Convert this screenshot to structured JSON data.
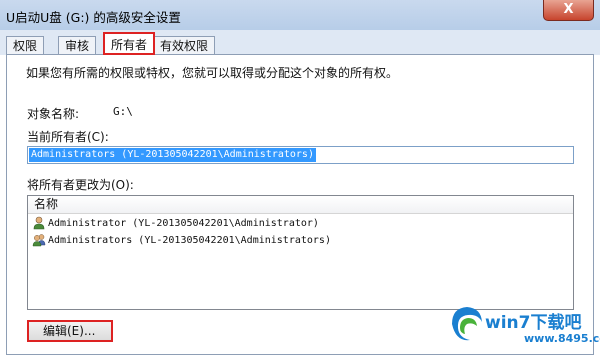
{
  "window": {
    "title": "U启动U盘 (G:) 的高级安全设置",
    "close_label": "X"
  },
  "tabs": [
    {
      "label": "权限"
    },
    {
      "label": "审核"
    },
    {
      "label": "所有者"
    },
    {
      "label": "有效权限"
    }
  ],
  "main": {
    "intro": "如果您有所需的权限或特权，您就可以取得或分配这个对象的所有权。",
    "object_name_label": "对象名称:",
    "object_name_value": "G:\\",
    "current_owner_label": "当前所有者(C):",
    "current_owner_value": "Administrators (YL-201305042201\\Administrators)",
    "change_owner_label": "将所有者更改为(O):",
    "list_header": "名称",
    "list_items": [
      {
        "icon": "user-icon",
        "text": "Administrator (YL-201305042201\\Administrator)"
      },
      {
        "icon": "group-icon",
        "text": "Administrators (YL-201305042201\\Administrators)"
      }
    ],
    "edit_button": "编辑(E)..."
  },
  "watermark": {
    "brand": "win7下载吧",
    "url": "www.8495.com"
  },
  "colors": {
    "highlight_border": "#dd2222",
    "selection": "#3399ff",
    "titlebar": "#c2d5ec"
  }
}
